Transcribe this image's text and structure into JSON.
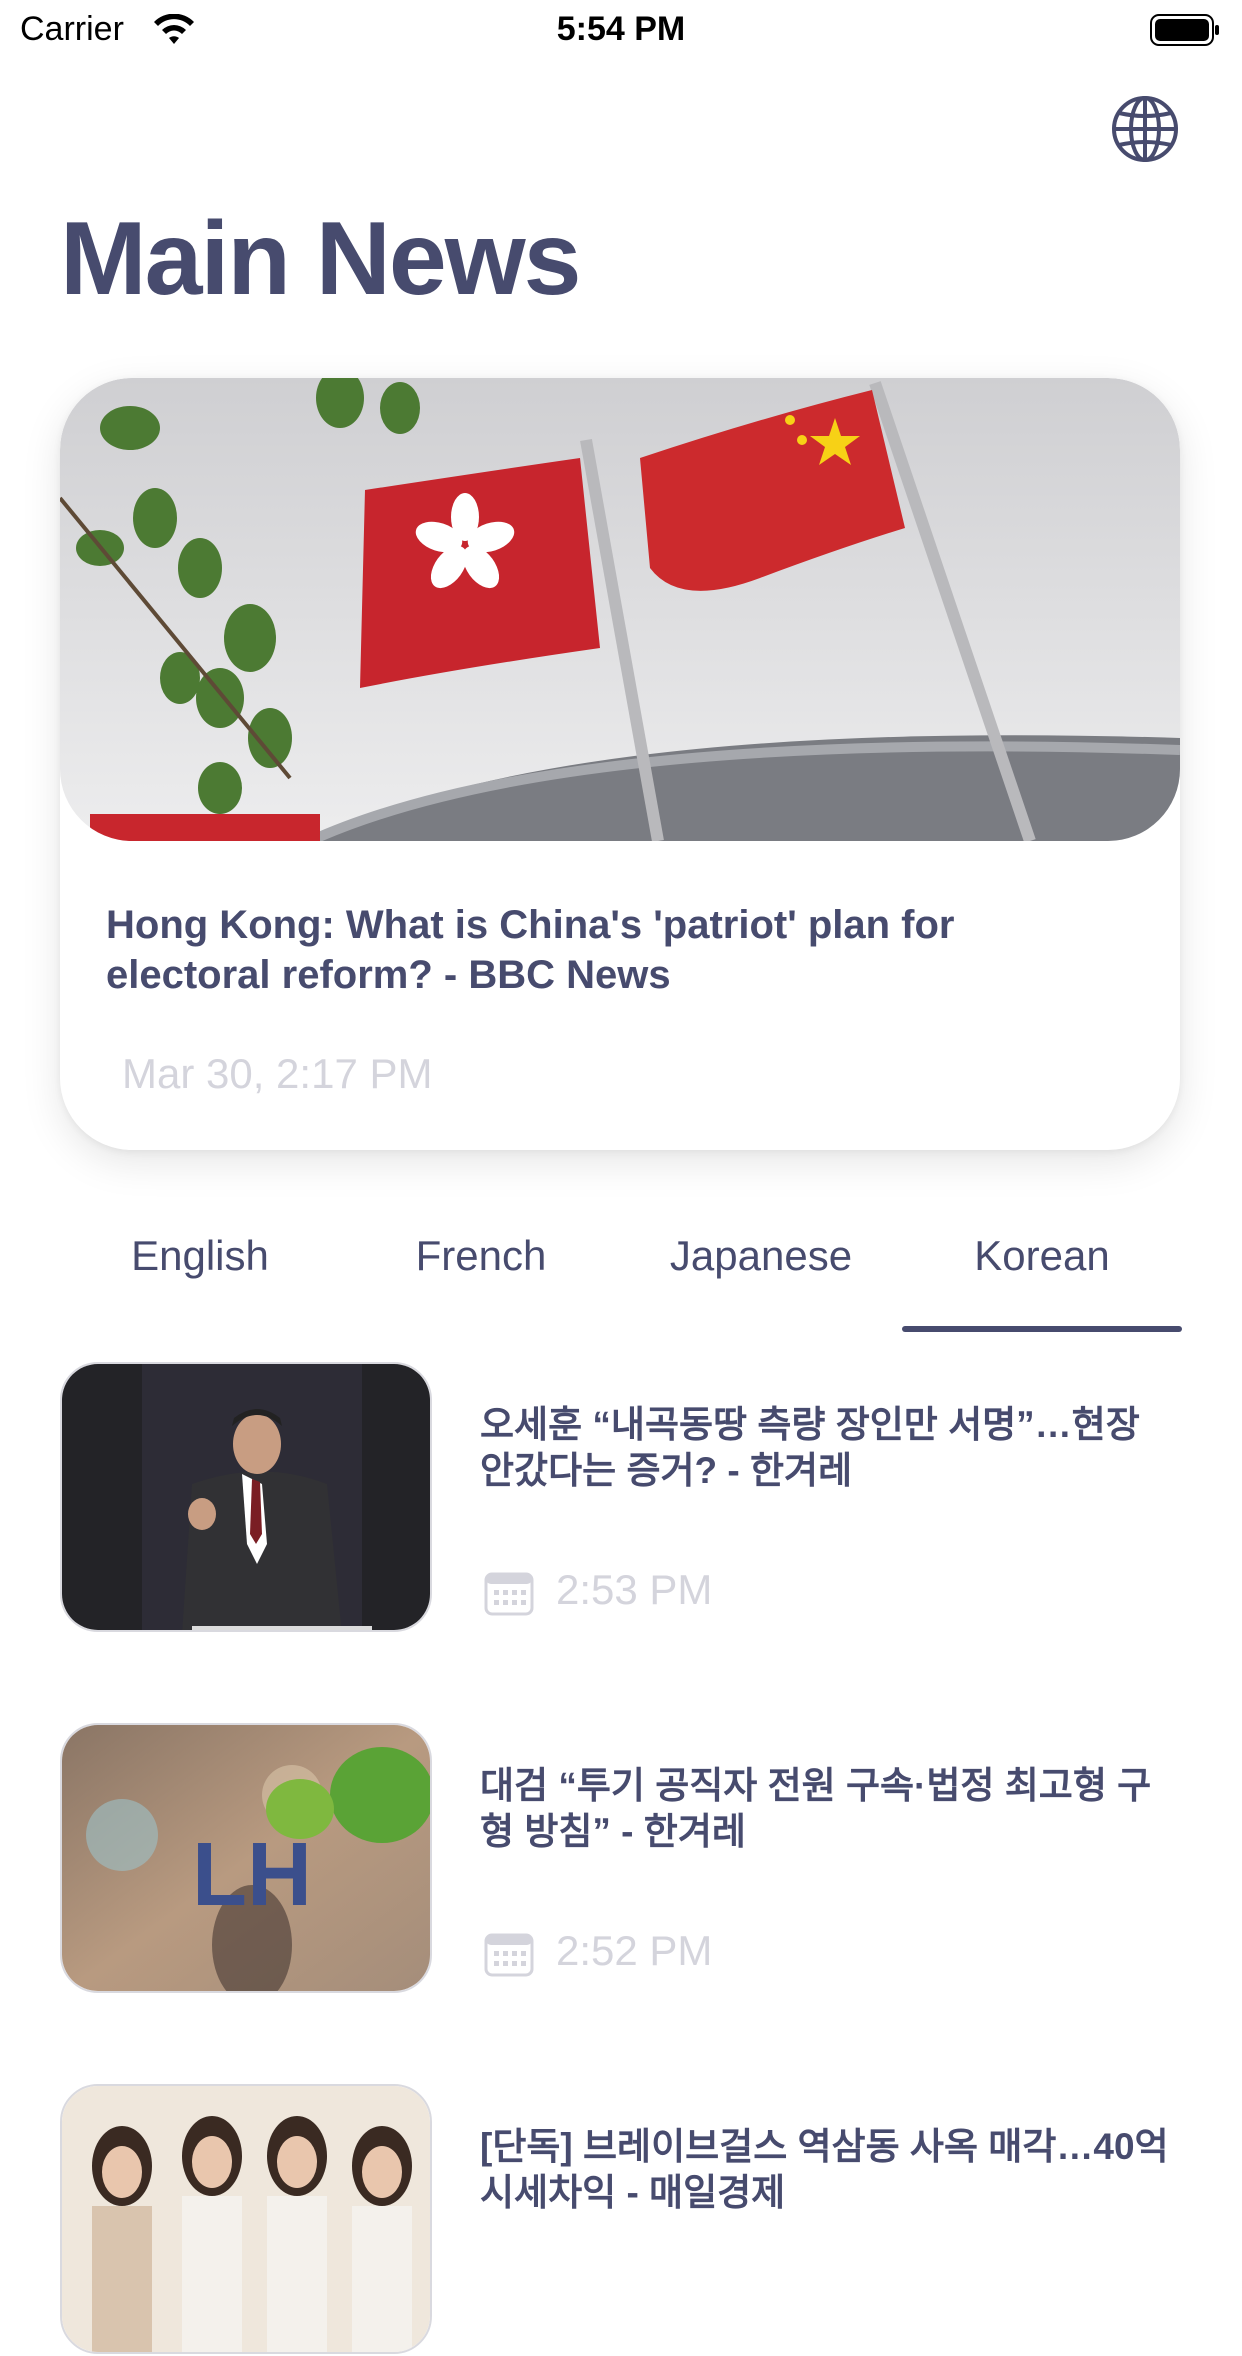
{
  "status_bar": {
    "carrier": "Carrier",
    "time": "5:54 PM"
  },
  "header": {
    "title": "Main News",
    "language_icon": "globe-icon"
  },
  "featured": {
    "headline": "Hong Kong: What is China's 'patriot' plan for electoral reform? - BBC News",
    "date": "Mar 30, 2:17 PM",
    "image": "hong-kong-and-china-flags-photo"
  },
  "tabs": [
    {
      "label": "English",
      "selected": false
    },
    {
      "label": "French",
      "selected": false
    },
    {
      "label": "Japanese",
      "selected": false
    },
    {
      "label": "Korean",
      "selected": true
    }
  ],
  "news": [
    {
      "title": "오세훈 “내곡동땅 측량 장인만 서명”…현장 안갔다는 증거? - 한겨레",
      "time": "2:53 PM",
      "image": "politician-speaking-photo",
      "icon": "calendar-icon"
    },
    {
      "title": "대검 “투기 공직자 전원 구속·법정 최고형 구형 방침” - 한겨레",
      "time": "2:52 PM",
      "image": "lh-logo-photo",
      "icon": "calendar-icon"
    },
    {
      "title": "[단독] 브레이브걸스 역삼동 사옥 매각…40억 시세차익 - 매일경제",
      "time": "",
      "image": "girl-group-photo",
      "icon": "calendar-icon"
    }
  ],
  "colors": {
    "accent": "#474b6e",
    "muted": "#d4d4dc",
    "background": "#ffffff"
  }
}
